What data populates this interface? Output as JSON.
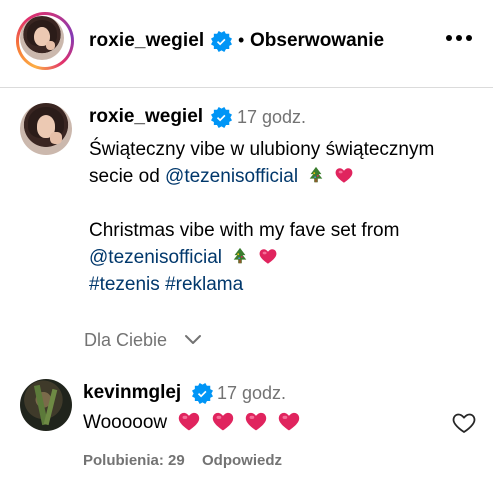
{
  "header": {
    "username": "roxie_wegiel",
    "separator": "•",
    "follow_label": "Obserwowanie"
  },
  "post": {
    "username": "roxie_wegiel",
    "time": "17 godz.",
    "caption": {
      "pl_line1": "Świąteczny vibe w ulubiony świątecznym",
      "pl_line2_prefix": "secie od ",
      "mention": "@tezenisofficial",
      "en_line1": "Christmas vibe with my fave set from",
      "hashtag1": "#tezenis",
      "hashtag2": "#reklama"
    }
  },
  "filter": {
    "label": "Dla Ciebie"
  },
  "comment": {
    "username": "kevinmglej",
    "time": "17 godz.",
    "text": "Wooooow",
    "likes_label": "Polubienia: 29",
    "reply_label": "Odpowiedz"
  },
  "icons": {
    "verified": "verified-badge-icon",
    "tree": "christmas-tree-icon",
    "heart": "red-heart-icon",
    "more": "more-options-icon",
    "chevron": "chevron-down-icon",
    "like": "heart-outline-icon"
  },
  "colors": {
    "verified_blue": "#0095f6",
    "link": "#00376b",
    "secondary_text": "#737373",
    "heart_red": "#e0245e"
  }
}
